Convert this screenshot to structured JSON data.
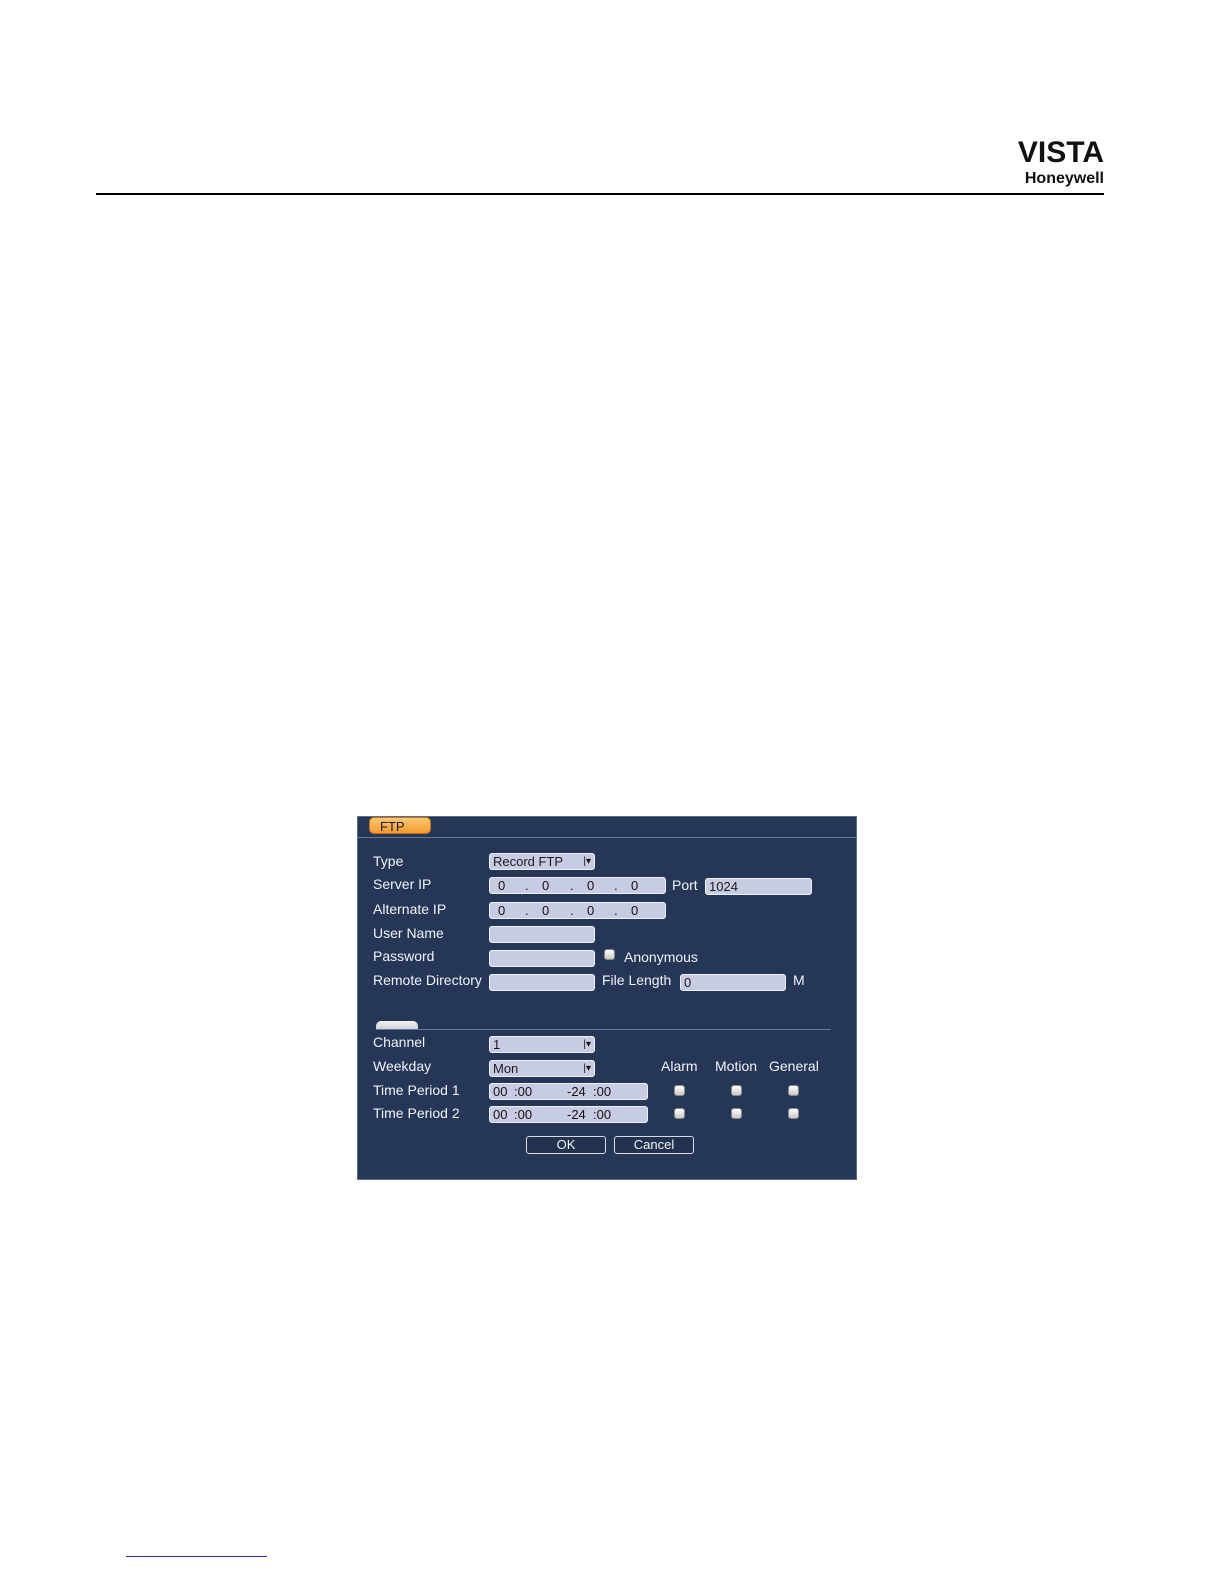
{
  "header": {
    "brand": "VISTA",
    "sub_brand": "Honeywell"
  },
  "dialog": {
    "tab_label": "FTP",
    "type": {
      "label": "Type",
      "value": "Record FTP"
    },
    "server_ip": {
      "label": "Server IP",
      "octets": [
        "0",
        "0",
        "0",
        "0"
      ]
    },
    "port": {
      "label": "Port",
      "value": "1024"
    },
    "alternate_ip": {
      "label": "Alternate IP",
      "octets": [
        "0",
        "0",
        "0",
        "0"
      ]
    },
    "user_name": {
      "label": "User Name",
      "value": ""
    },
    "password": {
      "label": "Password",
      "value": ""
    },
    "anonymous": {
      "label": "Anonymous",
      "checked": false
    },
    "remote_directory": {
      "label": "Remote Directory",
      "value": ""
    },
    "file_length": {
      "label": "File Length",
      "value": "0",
      "unit": "M"
    },
    "channel": {
      "label": "Channel",
      "value": "1"
    },
    "weekday": {
      "label": "Weekday",
      "value": "Mon"
    },
    "columns": {
      "alarm": "Alarm",
      "motion": "Motion",
      "general": "General"
    },
    "periods": [
      {
        "label": "Time Period 1",
        "start_h": "00",
        "start_m": ":00",
        "end_h": "-24",
        "end_m": ":00",
        "alarm": false,
        "motion": false,
        "general": false
      },
      {
        "label": "Time Period 2",
        "start_h": "00",
        "start_m": ":00",
        "end_h": "-24",
        "end_m": ":00",
        "alarm": false,
        "motion": false,
        "general": false
      }
    ],
    "ok_label": "OK",
    "cancel_label": "Cancel"
  },
  "colors": {
    "dialog_bg": "#263657",
    "field_bg": "#c8cbe4",
    "tab_accent": "#f39a2a"
  }
}
